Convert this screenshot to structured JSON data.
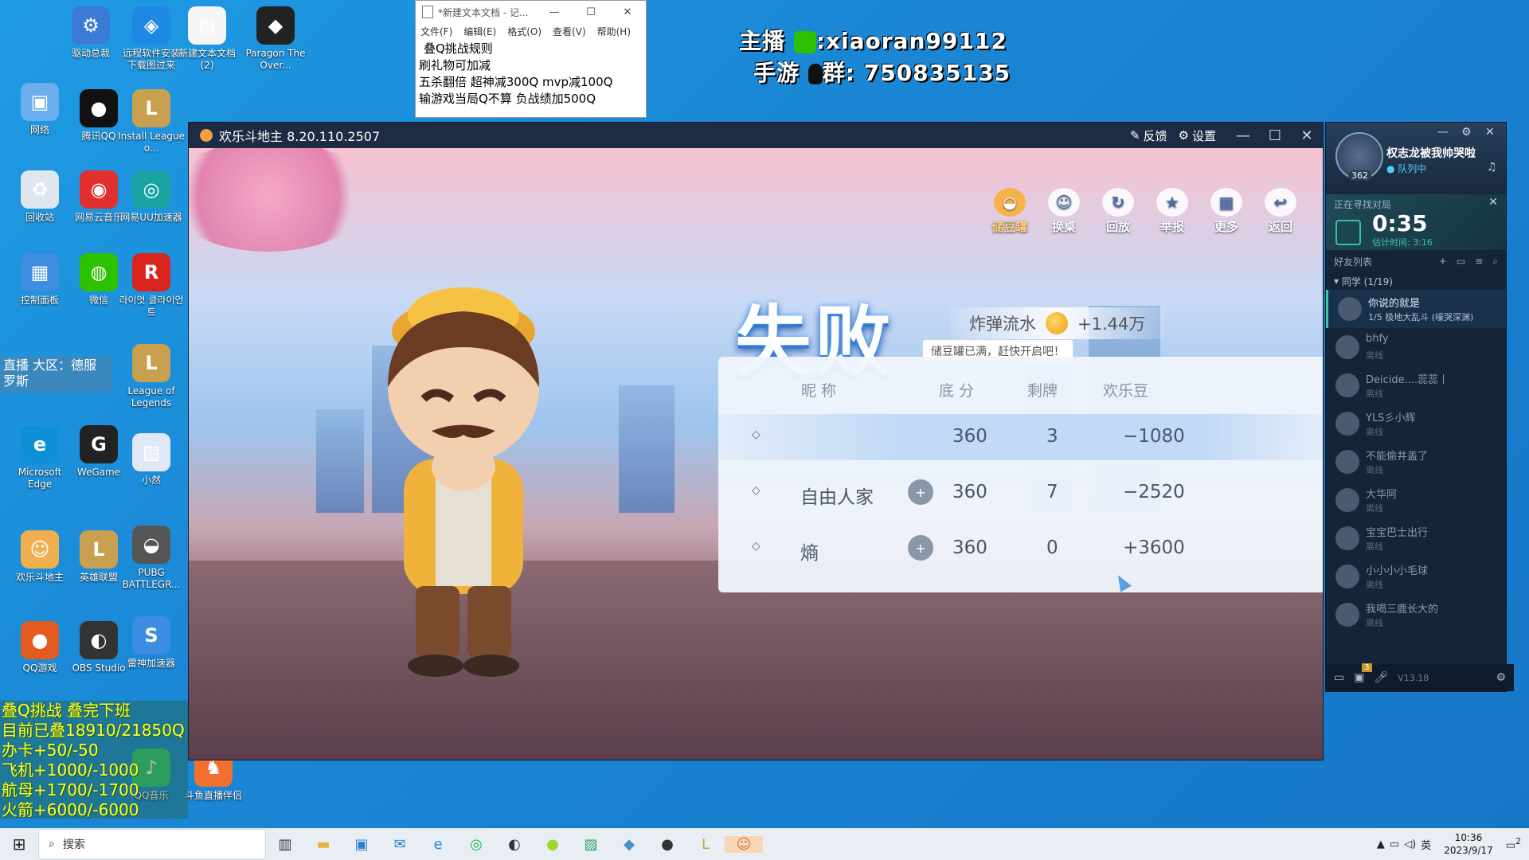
{
  "desktop": {
    "icons": [
      {
        "label": "驱动总裁",
        "glyph": "⚙",
        "color": "#3a7bd5"
      },
      {
        "label": "远程软件安装 下载图过来",
        "glyph": "◈",
        "color": "#1e88e5"
      },
      {
        "label": "新建文本文档 (2)",
        "glyph": "▤",
        "color": "#f5f5f5"
      },
      {
        "label": "Paragon The Over...",
        "glyph": "◆",
        "color": "#222"
      },
      {
        "label": "网络",
        "glyph": "▣",
        "color": "#6aaef0"
      },
      {
        "label": "腾讯QQ",
        "glyph": "●",
        "color": "#111"
      },
      {
        "label": "Install League o...",
        "glyph": "L",
        "color": "#c8a050"
      },
      {
        "label": "回收站",
        "glyph": "♻",
        "color": "#e0e6ee"
      },
      {
        "label": "网易云音乐",
        "glyph": "◉",
        "color": "#e03030"
      },
      {
        "label": "网易UU加速器",
        "glyph": "◎",
        "color": "#1aa3a3"
      },
      {
        "label": "控制面板",
        "glyph": "▦",
        "color": "#3d8de0"
      },
      {
        "label": "微信",
        "glyph": "◍",
        "color": "#2dc100"
      },
      {
        "label": "라이엇 클라이언트",
        "glyph": "R",
        "color": "#d9231f"
      },
      {
        "label": "League of Legends",
        "glyph": "L",
        "color": "#c8a050"
      },
      {
        "label": "Microsoft Edge",
        "glyph": "e",
        "color": "#0f8fd8"
      },
      {
        "label": "WeGame",
        "glyph": "G",
        "color": "#222"
      },
      {
        "label": "小然",
        "glyph": "▨",
        "color": "#dfe8f4"
      },
      {
        "label": "欢乐斗地主",
        "glyph": "☺",
        "color": "#f0b050"
      },
      {
        "label": "英雄联盟",
        "glyph": "L",
        "color": "#c8a050"
      },
      {
        "label": "PUBG BATTLEGR...",
        "glyph": "◒",
        "color": "#555"
      },
      {
        "label": "QQ游戏",
        "glyph": "●",
        "color": "#e35b20"
      },
      {
        "label": "OBS Studio",
        "glyph": "◐",
        "color": "#333"
      },
      {
        "label": "雷神加速器",
        "glyph": "S",
        "color": "#3a8de0"
      },
      {
        "label": "QQ音乐",
        "glyph": "♪",
        "color": "#31c27c"
      },
      {
        "label": "斗鱼直播伴侣",
        "glyph": "♞",
        "color": "#f07030"
      }
    ]
  },
  "overlay": {
    "anchor_label": "主播",
    "wechat_id": ":xiaoran99112",
    "group_label": "手游",
    "group_id": "群: 750835135"
  },
  "notepad": {
    "title": "*新建文本文档 - 记...",
    "menus": [
      "文件(F)",
      "编辑(E)",
      "格式(O)",
      "查看(V)",
      "帮助(H)"
    ],
    "lines": [
      "叠Q挑战规则",
      "刷礼物可加减",
      "五杀翻倍  超神减300Q mvp减100Q",
      "输游戏当局Q不算 负战绩加500Q"
    ]
  },
  "game": {
    "title": "欢乐斗地主 8.20.110.2507",
    "feedback": "反馈",
    "settings": "设置",
    "toolbar": [
      "储豆罐",
      "换桌",
      "回放",
      "举报",
      "更多",
      "返回"
    ],
    "tip": "储豆罐已满，赶快开启吧！",
    "result_title": "失败",
    "bomb_label": "炸弹流水",
    "bomb_value": "+1.44万",
    "headers": {
      "name": "昵 称",
      "base": "底 分",
      "left": "剩牌",
      "beans": "欢乐豆"
    },
    "rows": [
      {
        "name": "",
        "base": "360",
        "left": "3",
        "beans": "−1080",
        "highlight": true
      },
      {
        "name": "自由人家",
        "base": "360",
        "left": "7",
        "beans": "−2520",
        "highlight": false
      },
      {
        "name": "熵",
        "base": "360",
        "left": "0",
        "beans": "+3600",
        "highlight": false
      }
    ]
  },
  "qq": {
    "level": "362",
    "username": "权志龙被我帅哭啦",
    "status": "队列中",
    "search_label": "正在寻找对局",
    "timer": "0:35",
    "estimate": "估计时间: 3:16",
    "friends_label": "好友列表",
    "group": "同学 (1/19)",
    "friends": [
      {
        "name": "你说的就是",
        "status": "1/5 极地大乱斗 (嚎哭深渊)",
        "online": true
      },
      {
        "name": "bhfy",
        "status": "离线",
        "online": false
      },
      {
        "name": "Deicide....蕊蕊丨",
        "status": "离线",
        "online": false
      },
      {
        "name": "YLS彡小辉",
        "status": "离线",
        "online": false
      },
      {
        "name": "不能偷井盖了",
        "status": "离线",
        "online": false
      },
      {
        "name": "大华阿",
        "status": "离线",
        "online": false
      },
      {
        "name": "宝宝巴士出行",
        "status": "离线",
        "online": false
      },
      {
        "name": "小小小小毛球",
        "status": "离线",
        "online": false
      },
      {
        "name": "我喝三鹿长大的",
        "status": "离线",
        "online": false
      }
    ],
    "badge": "3",
    "version": "V13.18"
  },
  "live_box": "直播 大区：德服罗斯",
  "challenge": {
    "lines": [
      "叠Q挑战 叠完下班",
      "目前已叠18910/21850Q",
      "办卡+50/-50",
      "飞机+1000/-1000",
      "航母+1700/-1700",
      "火箭+6000/-6000"
    ]
  },
  "taskbar": {
    "search_placeholder": "搜索",
    "ime": "英",
    "time": "10:36",
    "date": "2023/9/17",
    "notif": "2"
  }
}
